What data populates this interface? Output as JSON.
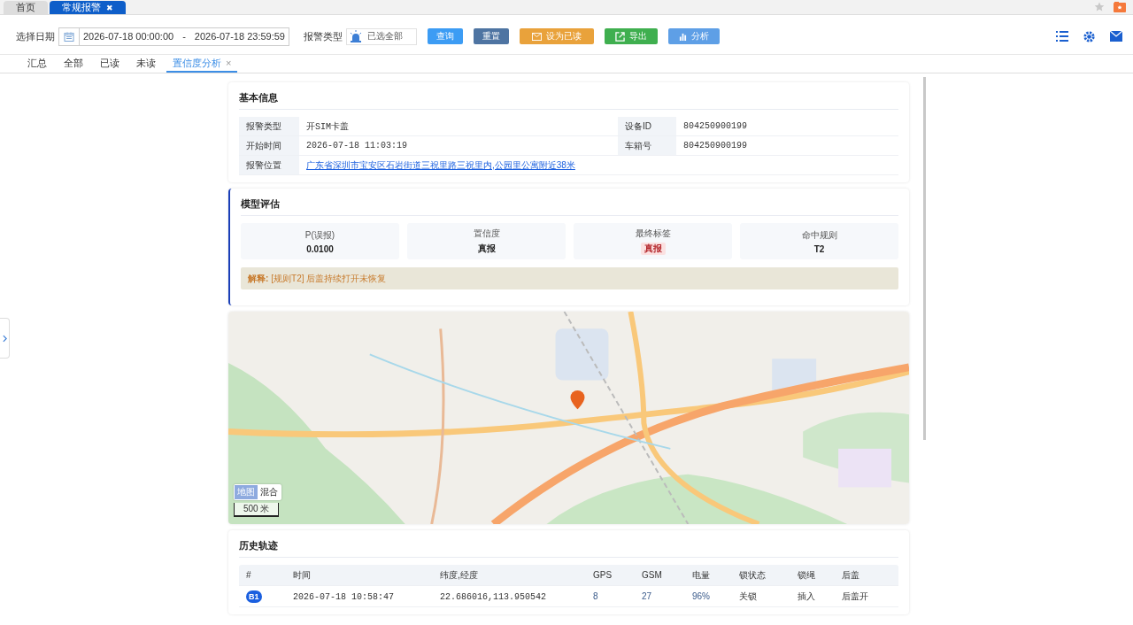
{
  "top_tabs": [
    {
      "label": "首页",
      "selected": false,
      "closable": false
    },
    {
      "label": "常规报警",
      "selected": true,
      "closable": true
    }
  ],
  "close_glyph": "✖",
  "toolbar": {
    "date_label": "选择日期",
    "date_start": "2026-07-18 00:00:00",
    "date_sep": "-",
    "date_end": "2026-07-18 23:59:59",
    "type_label": "报警类型",
    "type_value": "已选全部",
    "buttons": [
      {
        "label": "查询",
        "kind": "primary"
      },
      {
        "label": "重置",
        "kind": "dark"
      },
      {
        "label": "设为已读",
        "kind": "warn"
      },
      {
        "label": "导出",
        "kind": "success"
      },
      {
        "label": "分析",
        "kind": "info"
      }
    ]
  },
  "sub_tabs": [
    {
      "label": "汇总",
      "selected": false,
      "closable": false
    },
    {
      "label": "全部",
      "selected": false,
      "closable": false
    },
    {
      "label": "已读",
      "selected": false,
      "closable": false
    },
    {
      "label": "未读",
      "selected": false,
      "closable": false
    },
    {
      "label": "置信度分析",
      "selected": true,
      "closable": true
    }
  ],
  "sub_close": "×",
  "basic_info": {
    "title": "基本信息",
    "rows": [
      {
        "label": "报警类型",
        "value": "开SIM卡盖",
        "label2": "设备ID",
        "value2": "804250900199"
      },
      {
        "label": "开始时间",
        "value": "2026-07-18 11:03:19",
        "label2": "车箱号",
        "value2": "804250900199"
      },
      {
        "label": "报警位置",
        "value": "广东省深圳市宝安区石岩街道三祝里路三祝里内,公园里公寓附近38米",
        "link": true
      }
    ]
  },
  "model": {
    "title": "模型评估",
    "metrics": [
      {
        "label": "P(误报)",
        "value": "0.0100",
        "kind": "plain"
      },
      {
        "label": "置信度",
        "value": "真报",
        "kind": "plain"
      },
      {
        "label": "最终标签",
        "value": "真报",
        "kind": "tag"
      },
      {
        "label": "命中规则",
        "value": "T2",
        "kind": "plain"
      }
    ],
    "note_label": "解释:",
    "note_text": "[规则T2] 后盖持续打开未恢复"
  },
  "map": {
    "modes": [
      {
        "label": "地图",
        "selected": true
      },
      {
        "label": "混合",
        "selected": false
      }
    ],
    "scale": "500 米"
  },
  "history": {
    "title": "历史轨迹",
    "columns": [
      "#",
      "时间",
      "纬度,经度",
      "GPS",
      "GSM",
      "电量",
      "锁状态",
      "锁绳",
      "后盖"
    ],
    "rows": [
      [
        "B1",
        "2026-07-18 10:58:47",
        "22.686016,113.950542",
        "8",
        "27",
        "96%",
        "关锁",
        "插入",
        "后盖开"
      ]
    ]
  }
}
